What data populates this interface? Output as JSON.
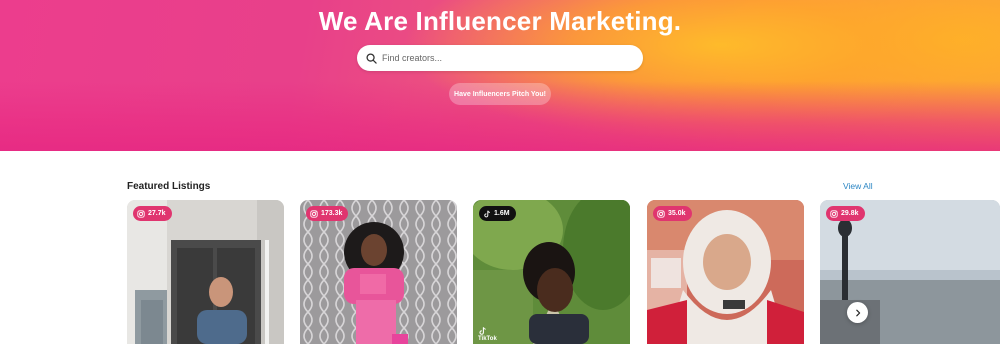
{
  "hero": {
    "title": "We Are Influencer Marketing.",
    "search_placeholder": "Find creators...",
    "pitch_button": "Have Influencers Pitch You!"
  },
  "featured": {
    "title": "Featured Listings",
    "view_all": "View All",
    "cards": [
      {
        "platform": "instagram",
        "icon": "instagram-icon",
        "followers": "27.7k"
      },
      {
        "platform": "instagram",
        "icon": "instagram-icon",
        "followers": "173.3k"
      },
      {
        "platform": "tiktok",
        "icon": "tiktok-icon",
        "followers": "1.6M",
        "watermark": "TikTok"
      },
      {
        "platform": "instagram",
        "icon": "instagram-icon",
        "followers": "35.0k"
      },
      {
        "platform": "instagram",
        "icon": "instagram-icon",
        "followers": "29.8k"
      }
    ]
  },
  "colors": {
    "accent_pink": "#e8408a",
    "accent_orange": "#fb9a3b",
    "link_blue": "#2c86c4",
    "badge_instagram": "#e0356f",
    "badge_tiktok": "#111111"
  }
}
